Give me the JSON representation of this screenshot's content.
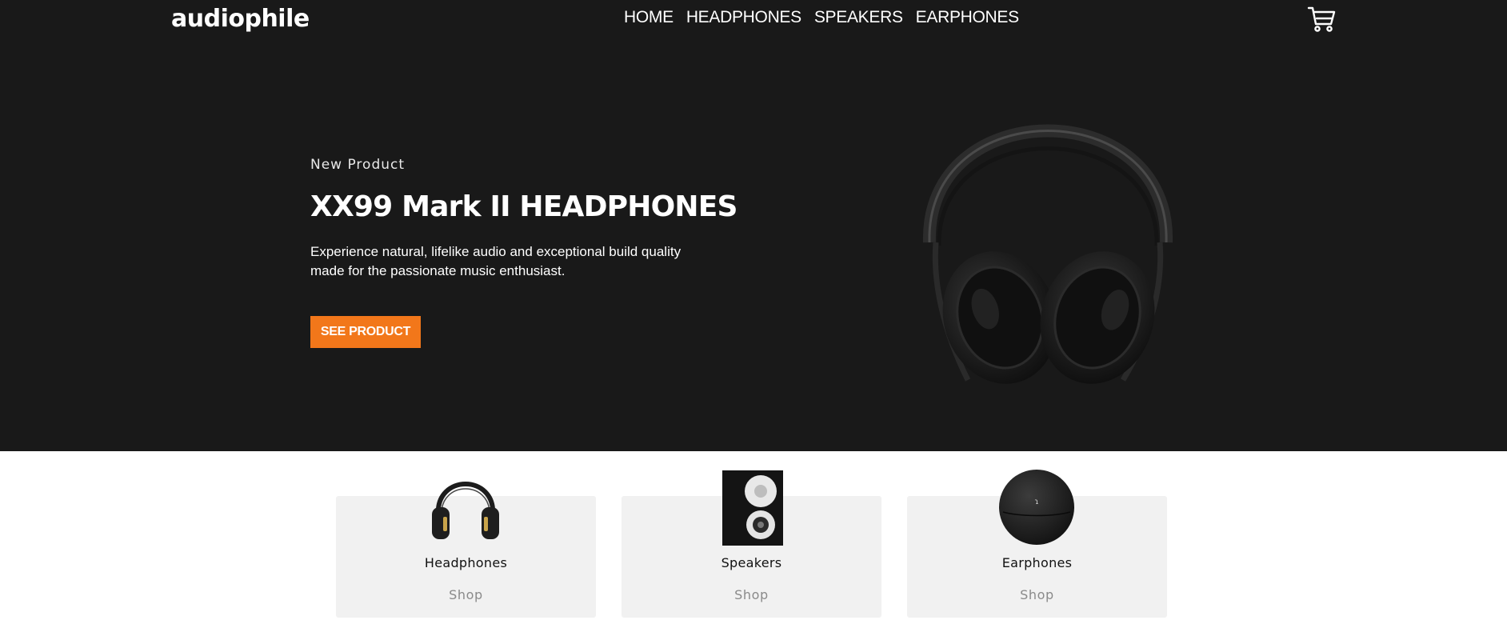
{
  "header": {
    "logo": "audiophile",
    "nav": [
      "HOME",
      "HEADPHONES",
      "SPEAKERS",
      "EARPHONES"
    ],
    "cart_icon": "cart-icon"
  },
  "hero": {
    "overline": "New Product",
    "title": "XX99 Mark II HEADPHONES",
    "description": "Experience natural, lifelike audio and exceptional build quality made for the passionate music enthusiast.",
    "cta_label": "SEE PRODUCT",
    "image": "headphones-product-image"
  },
  "categories": [
    {
      "name": "Headphones",
      "shop_label": "Shop",
      "image": "headphones-thumbnail"
    },
    {
      "name": "Speakers",
      "shop_label": "Shop",
      "image": "speaker-thumbnail"
    },
    {
      "name": "Earphones",
      "shop_label": "Shop",
      "image": "earphones-case-thumbnail"
    }
  ],
  "colors": {
    "hero_bg": "#191919",
    "accent": "#f2771a",
    "card_bg": "#f1f1f1",
    "text_light": "#ffffff",
    "text_muted": "#8a8a8a"
  }
}
